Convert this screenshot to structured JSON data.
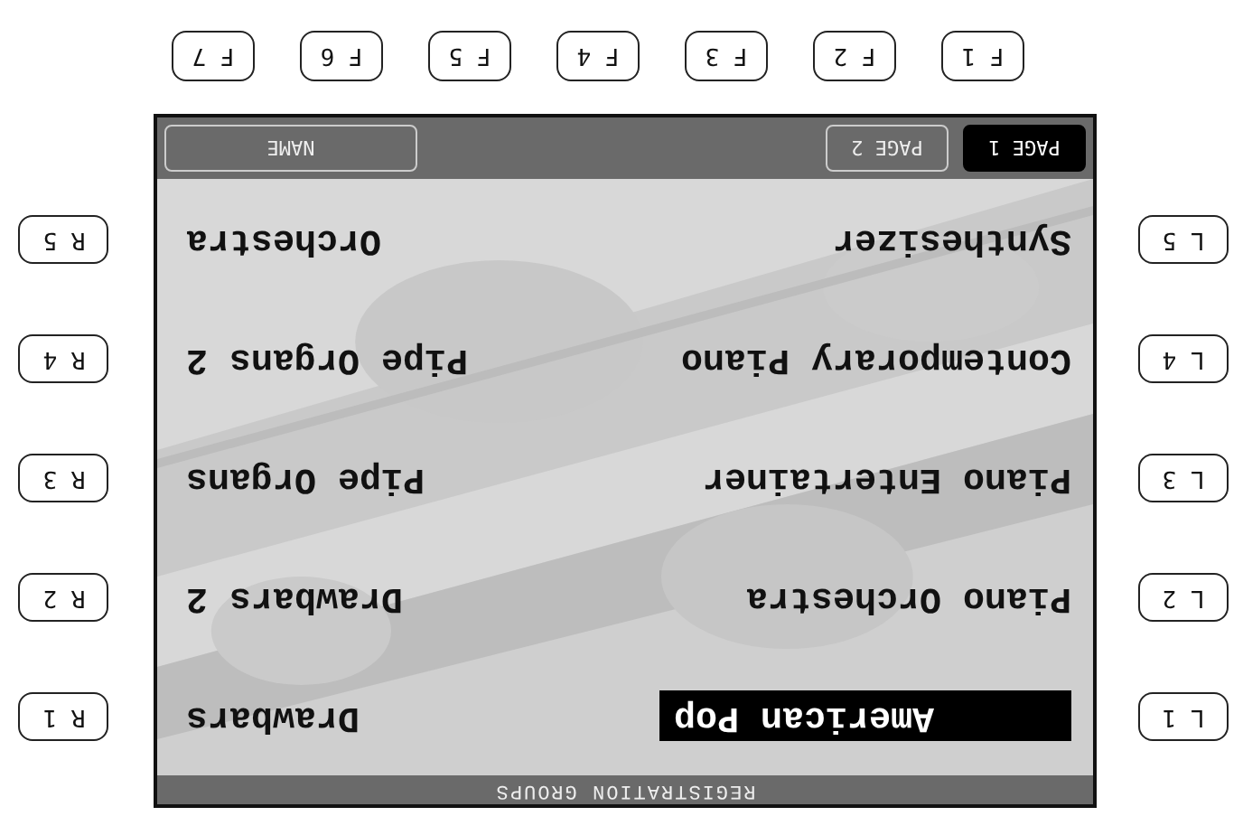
{
  "title": "REGISTRATION GROUPS",
  "left_items": [
    {
      "label": "American Pop",
      "selected": true
    },
    {
      "label": "Piano Orchestra",
      "selected": false
    },
    {
      "label": "Piano Entertainer",
      "selected": false
    },
    {
      "label": "Contemporary Piano",
      "selected": false
    },
    {
      "label": "Synthesizer",
      "selected": false
    }
  ],
  "right_items": [
    {
      "label": "Drawbars",
      "selected": false
    },
    {
      "label": "Drawbars 2",
      "selected": false
    },
    {
      "label": "Pipe Organs",
      "selected": false
    },
    {
      "label": "Pipe Organs 2",
      "selected": false
    },
    {
      "label": "Orchestra",
      "selected": false
    }
  ],
  "tabs": [
    {
      "label": "PAGE 1",
      "selected": true
    },
    {
      "label": "PAGE 2",
      "selected": false
    }
  ],
  "name_button": "NAME",
  "left_buttons": [
    "L 1",
    "L 2",
    "L 3",
    "L 4",
    "L 5"
  ],
  "right_buttons": [
    "R 1",
    "R 2",
    "R 3",
    "R 4",
    "R 5"
  ],
  "function_buttons": [
    "F 1",
    "F 2",
    "F 3",
    "F 4",
    "F 5",
    "F 6",
    "F 7"
  ]
}
